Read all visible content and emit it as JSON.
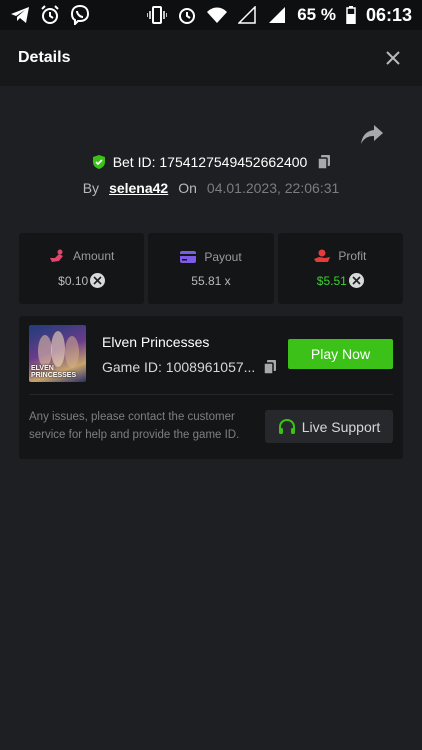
{
  "status_bar": {
    "battery": "65 %",
    "time": "06:13",
    "icons": [
      "telegram-icon",
      "alarm-icon",
      "viber-icon",
      "vibrate-icon",
      "alarm-icon",
      "wifi-icon",
      "signal-icon",
      "signal-icon",
      "battery-icon"
    ]
  },
  "header": {
    "title": "Details"
  },
  "bet": {
    "id_label": "Bet ID: 1754127549452662400",
    "by_label": "By",
    "username": "selena42",
    "on_label": "On",
    "date": "04.01.2023, 22:06:31"
  },
  "stats": {
    "amount": {
      "label": "Amount",
      "value": "$0.10"
    },
    "payout": {
      "label": "Payout",
      "value": "55.81 x"
    },
    "profit": {
      "label": "Profit",
      "value": "$5.51"
    }
  },
  "game": {
    "name": "Elven Princesses",
    "game_id": "Game ID: 1008961057...",
    "thumb_text": "ELVEN PRINCESSES",
    "play_label": "Play Now"
  },
  "support": {
    "text": "Any issues, please contact the customer service for help and provide the game ID.",
    "button_label": "Live Support"
  },
  "colors": {
    "accent_green": "#3bc117",
    "profit_green": "#39d12b",
    "background": "#1e1f22",
    "card": "#141517",
    "amount_icon": "#e0456e",
    "payout_icon": "#7c5ce6",
    "profit_icon": "#e53b3b"
  }
}
